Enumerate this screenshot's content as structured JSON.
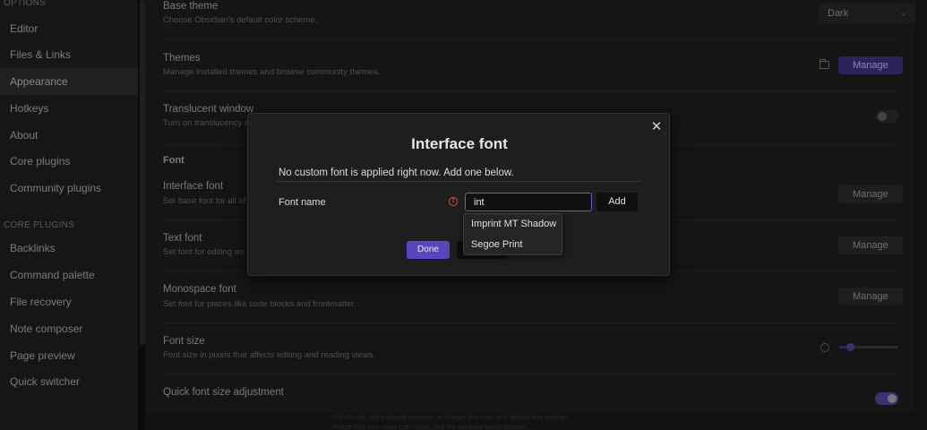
{
  "sidebar": {
    "options_heading": "OPTIONS",
    "options_items": [
      "Editor",
      "Files & Links",
      "Appearance",
      "Hotkeys",
      "About",
      "Core plugins",
      "Community plugins"
    ],
    "core_heading": "CORE PLUGINS",
    "core_items": [
      "Backlinks",
      "Command palette",
      "File recovery",
      "Note composer",
      "Page preview",
      "Quick switcher"
    ]
  },
  "settings": {
    "base_theme": {
      "title": "Base theme",
      "desc": "Choose Obsidian's default color scheme.",
      "value": "Dark"
    },
    "themes": {
      "title": "Themes",
      "desc": "Manage installed themes and browse community themes.",
      "button": "Manage"
    },
    "translucent": {
      "title": "Translucent window",
      "desc": "Turn on translucency e"
    },
    "font_heading": "Font",
    "interface_font": {
      "title": "Interface font",
      "desc": "Set base font for all of",
      "button": "Manage"
    },
    "text_font": {
      "title": "Text font",
      "desc": "Set font for editing an",
      "button": "Manage"
    },
    "mono_font": {
      "title": "Monospace font",
      "desc": "Set font for places like code blocks and frontmatter.",
      "button": "Manage"
    },
    "font_size": {
      "title": "Font size",
      "desc": "Font size in pixels that affects editing and reading views.",
      "value_fraction": 0.18
    },
    "quick_font": {
      "title": "Quick font size adjustment"
    }
  },
  "footer": {
    "line1": "Ctrl+Scroll, and trackpad gestures to change font size, and default font settings.",
    "line2": "Adjust font size using Ctrl+Scroll, and the trackpad pinch gesture."
  },
  "modal": {
    "title": "Interface font",
    "message": "No custom font is applied right now. Add one below.",
    "font_label": "Font name",
    "input_value": "int",
    "add_button": "Add",
    "done_button": "Done",
    "warning_icon": "!",
    "close_icon": "✕"
  },
  "suggestions": [
    "Imprint MT Shadow",
    "Segoe Print"
  ],
  "colors": {
    "accent": "#5a45c0",
    "input_focus": "#6d5dd3",
    "warning": "#e05252"
  }
}
